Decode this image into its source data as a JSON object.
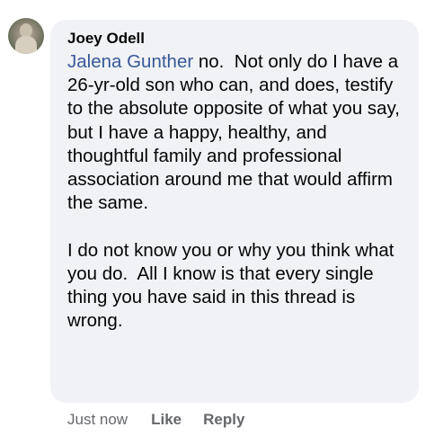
{
  "comment": {
    "author": "Joey Odell",
    "mention": "Jalena Gunther",
    "body_paragraph_1": " no.  Not only do I have a 26-yr-old son who can, and does, testify to the absolute opposite of what you say, but I have a happy, healthy, and thoughtful family and professional association around me that would affirm the same.",
    "body_paragraph_2": "I do not know you or why you think what you do.  All I know is that every single thing you have said in this thread is wrong.",
    "timestamp": "Just now",
    "like_label": "Like",
    "reply_label": "Reply"
  },
  "colors": {
    "bubble_background": "#f0f2f5",
    "mention": "#385898",
    "meta_text": "#65676b"
  },
  "icons": {
    "avatar": "profile-photo"
  }
}
